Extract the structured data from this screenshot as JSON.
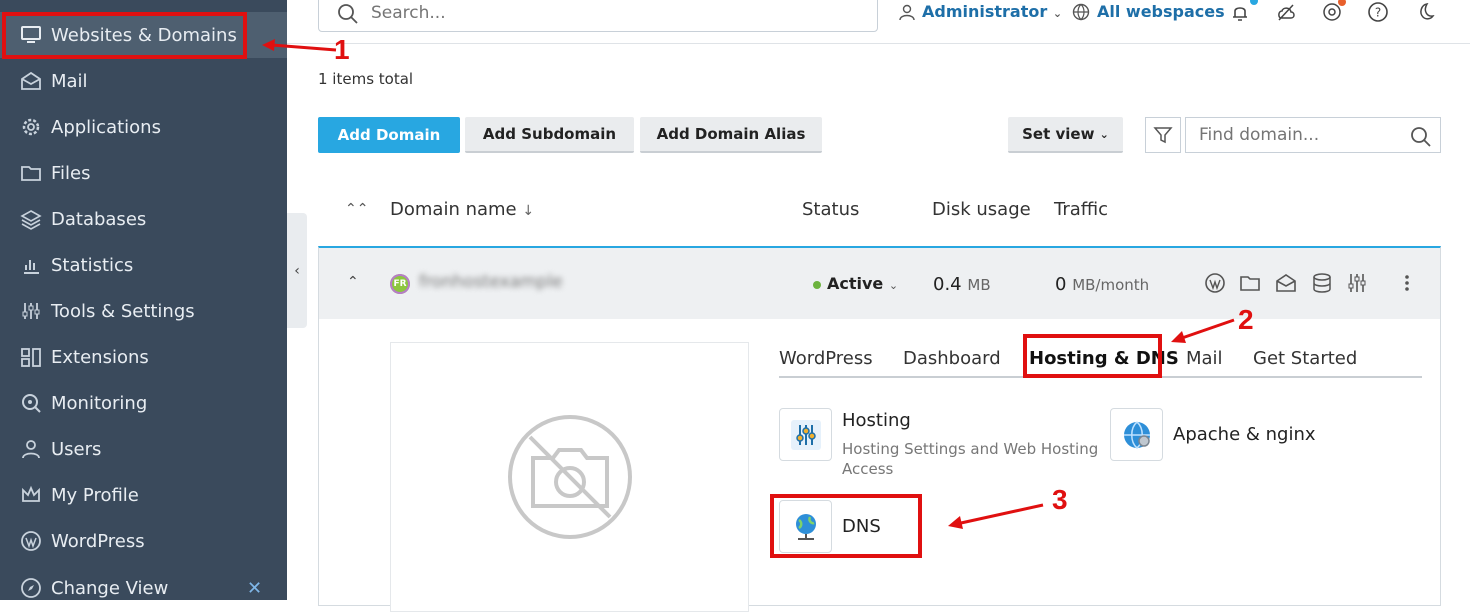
{
  "sidebar": {
    "items": [
      {
        "label": "Websites & Domains",
        "icon": "monitor-icon",
        "active": true
      },
      {
        "label": "Mail",
        "icon": "mail-icon"
      },
      {
        "label": "Applications",
        "icon": "gear-icon"
      },
      {
        "label": "Files",
        "icon": "folder-icon"
      },
      {
        "label": "Databases",
        "icon": "layers-icon"
      },
      {
        "label": "Statistics",
        "icon": "bar-chart-icon"
      },
      {
        "label": "Tools & Settings",
        "icon": "sliders-icon"
      },
      {
        "label": "Extensions",
        "icon": "puzzle-icon"
      },
      {
        "label": "Monitoring",
        "icon": "magnifier-icon"
      },
      {
        "label": "Users",
        "icon": "user-icon"
      },
      {
        "label": "My Profile",
        "icon": "crown-icon"
      },
      {
        "label": "WordPress",
        "icon": "wordpress-icon"
      },
      {
        "label": "Change View",
        "icon": "compass-icon"
      }
    ]
  },
  "header": {
    "search_placeholder": "Search...",
    "user_label": "Administrator",
    "webspaces_label": "All webspaces"
  },
  "main": {
    "items_total": "1 items total",
    "buttons": {
      "add_domain": "Add Domain",
      "add_subdomain": "Add Subdomain",
      "add_alias": "Add Domain Alias",
      "set_view": "Set view"
    },
    "find_placeholder": "Find domain...",
    "columns": {
      "domain_name": "Domain name",
      "status": "Status",
      "disk_usage": "Disk usage",
      "traffic": "Traffic"
    }
  },
  "domain": {
    "badge": "FR",
    "name": "fronhostexample",
    "status": "Active",
    "disk_value": "0.4",
    "disk_unit": "MB",
    "traffic_value": "0",
    "traffic_unit": "MB/month",
    "tabs": [
      "WordPress",
      "Dashboard",
      "Hosting & DNS",
      "Mail",
      "Get Started"
    ],
    "tools": {
      "hosting_title": "Hosting",
      "hosting_desc": "Hosting Settings and Web Hosting Access",
      "apache_title": "Apache & nginx",
      "dns_title": "DNS"
    }
  },
  "annotations": {
    "step1": "1",
    "step2": "2",
    "step3": "3",
    "color": "#e01010"
  },
  "colors": {
    "sidebar_bg": "#3a4a5c",
    "accent": "#28a7e1",
    "link": "#1e6fa8",
    "status_active": "#6cb33e"
  }
}
